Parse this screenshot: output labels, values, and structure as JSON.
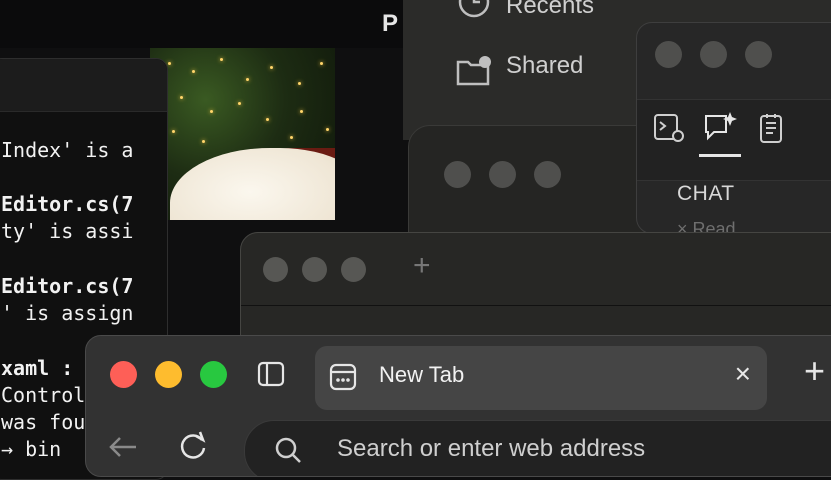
{
  "background_app": {
    "letter": "P"
  },
  "terminal": {
    "lines": [
      "Index' is a",
      "Editor.cs(7",
      "ty' is assi",
      "Editor.cs(7",
      "' is assign",
      "xaml :",
      "Controls",
      "was fou",
      "→ bin"
    ]
  },
  "finder": {
    "items": [
      {
        "label": "Recents",
        "icon": "clock-icon"
      },
      {
        "label": "Shared",
        "icon": "shared-folder-icon"
      }
    ]
  },
  "chat_panel": {
    "tabs": [
      {
        "icon": "debug-console-icon"
      },
      {
        "icon": "chat-sparkle-icon",
        "active": true
      },
      {
        "icon": "notes-icon"
      }
    ],
    "section_label": "CHAT",
    "peek_text": "× Read"
  },
  "editor_window": {
    "new_tab_symbol": "+"
  },
  "browser": {
    "tab": {
      "title": "New Tab",
      "close": "×"
    },
    "new_tab_symbol": "+",
    "address_placeholder": "Search or enter web address",
    "colors": {
      "close": "#fe5f57",
      "minimize": "#febc2e",
      "zoom": "#28c840"
    }
  }
}
